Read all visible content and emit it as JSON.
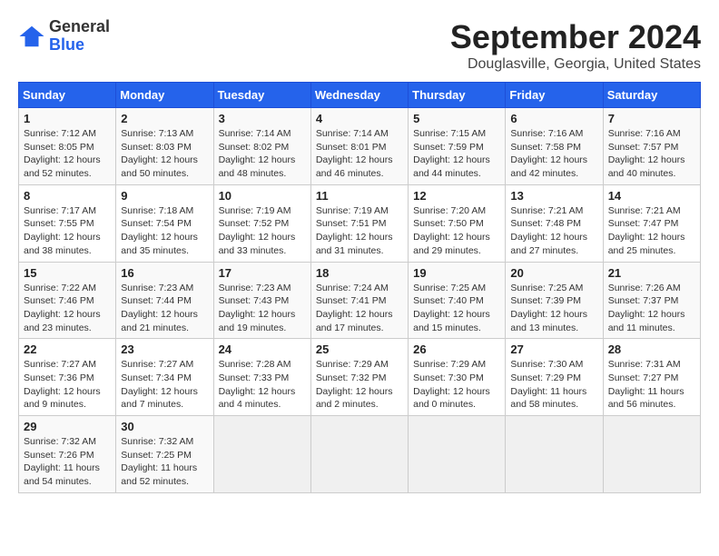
{
  "logo": {
    "general": "General",
    "blue": "Blue"
  },
  "header": {
    "month": "September 2024",
    "location": "Douglasville, Georgia, United States"
  },
  "days_of_week": [
    "Sunday",
    "Monday",
    "Tuesday",
    "Wednesday",
    "Thursday",
    "Friday",
    "Saturday"
  ],
  "weeks": [
    [
      {
        "day": "1",
        "info": "Sunrise: 7:12 AM\nSunset: 8:05 PM\nDaylight: 12 hours\nand 52 minutes."
      },
      {
        "day": "2",
        "info": "Sunrise: 7:13 AM\nSunset: 8:03 PM\nDaylight: 12 hours\nand 50 minutes."
      },
      {
        "day": "3",
        "info": "Sunrise: 7:14 AM\nSunset: 8:02 PM\nDaylight: 12 hours\nand 48 minutes."
      },
      {
        "day": "4",
        "info": "Sunrise: 7:14 AM\nSunset: 8:01 PM\nDaylight: 12 hours\nand 46 minutes."
      },
      {
        "day": "5",
        "info": "Sunrise: 7:15 AM\nSunset: 7:59 PM\nDaylight: 12 hours\nand 44 minutes."
      },
      {
        "day": "6",
        "info": "Sunrise: 7:16 AM\nSunset: 7:58 PM\nDaylight: 12 hours\nand 42 minutes."
      },
      {
        "day": "7",
        "info": "Sunrise: 7:16 AM\nSunset: 7:57 PM\nDaylight: 12 hours\nand 40 minutes."
      }
    ],
    [
      {
        "day": "8",
        "info": "Sunrise: 7:17 AM\nSunset: 7:55 PM\nDaylight: 12 hours\nand 38 minutes."
      },
      {
        "day": "9",
        "info": "Sunrise: 7:18 AM\nSunset: 7:54 PM\nDaylight: 12 hours\nand 35 minutes."
      },
      {
        "day": "10",
        "info": "Sunrise: 7:19 AM\nSunset: 7:52 PM\nDaylight: 12 hours\nand 33 minutes."
      },
      {
        "day": "11",
        "info": "Sunrise: 7:19 AM\nSunset: 7:51 PM\nDaylight: 12 hours\nand 31 minutes."
      },
      {
        "day": "12",
        "info": "Sunrise: 7:20 AM\nSunset: 7:50 PM\nDaylight: 12 hours\nand 29 minutes."
      },
      {
        "day": "13",
        "info": "Sunrise: 7:21 AM\nSunset: 7:48 PM\nDaylight: 12 hours\nand 27 minutes."
      },
      {
        "day": "14",
        "info": "Sunrise: 7:21 AM\nSunset: 7:47 PM\nDaylight: 12 hours\nand 25 minutes."
      }
    ],
    [
      {
        "day": "15",
        "info": "Sunrise: 7:22 AM\nSunset: 7:46 PM\nDaylight: 12 hours\nand 23 minutes."
      },
      {
        "day": "16",
        "info": "Sunrise: 7:23 AM\nSunset: 7:44 PM\nDaylight: 12 hours\nand 21 minutes."
      },
      {
        "day": "17",
        "info": "Sunrise: 7:23 AM\nSunset: 7:43 PM\nDaylight: 12 hours\nand 19 minutes."
      },
      {
        "day": "18",
        "info": "Sunrise: 7:24 AM\nSunset: 7:41 PM\nDaylight: 12 hours\nand 17 minutes."
      },
      {
        "day": "19",
        "info": "Sunrise: 7:25 AM\nSunset: 7:40 PM\nDaylight: 12 hours\nand 15 minutes."
      },
      {
        "day": "20",
        "info": "Sunrise: 7:25 AM\nSunset: 7:39 PM\nDaylight: 12 hours\nand 13 minutes."
      },
      {
        "day": "21",
        "info": "Sunrise: 7:26 AM\nSunset: 7:37 PM\nDaylight: 12 hours\nand 11 minutes."
      }
    ],
    [
      {
        "day": "22",
        "info": "Sunrise: 7:27 AM\nSunset: 7:36 PM\nDaylight: 12 hours\nand 9 minutes."
      },
      {
        "day": "23",
        "info": "Sunrise: 7:27 AM\nSunset: 7:34 PM\nDaylight: 12 hours\nand 7 minutes."
      },
      {
        "day": "24",
        "info": "Sunrise: 7:28 AM\nSunset: 7:33 PM\nDaylight: 12 hours\nand 4 minutes."
      },
      {
        "day": "25",
        "info": "Sunrise: 7:29 AM\nSunset: 7:32 PM\nDaylight: 12 hours\nand 2 minutes."
      },
      {
        "day": "26",
        "info": "Sunrise: 7:29 AM\nSunset: 7:30 PM\nDaylight: 12 hours\nand 0 minutes."
      },
      {
        "day": "27",
        "info": "Sunrise: 7:30 AM\nSunset: 7:29 PM\nDaylight: 11 hours\nand 58 minutes."
      },
      {
        "day": "28",
        "info": "Sunrise: 7:31 AM\nSunset: 7:27 PM\nDaylight: 11 hours\nand 56 minutes."
      }
    ],
    [
      {
        "day": "29",
        "info": "Sunrise: 7:32 AM\nSunset: 7:26 PM\nDaylight: 11 hours\nand 54 minutes."
      },
      {
        "day": "30",
        "info": "Sunrise: 7:32 AM\nSunset: 7:25 PM\nDaylight: 11 hours\nand 52 minutes."
      },
      {
        "day": "",
        "info": ""
      },
      {
        "day": "",
        "info": ""
      },
      {
        "day": "",
        "info": ""
      },
      {
        "day": "",
        "info": ""
      },
      {
        "day": "",
        "info": ""
      }
    ]
  ]
}
